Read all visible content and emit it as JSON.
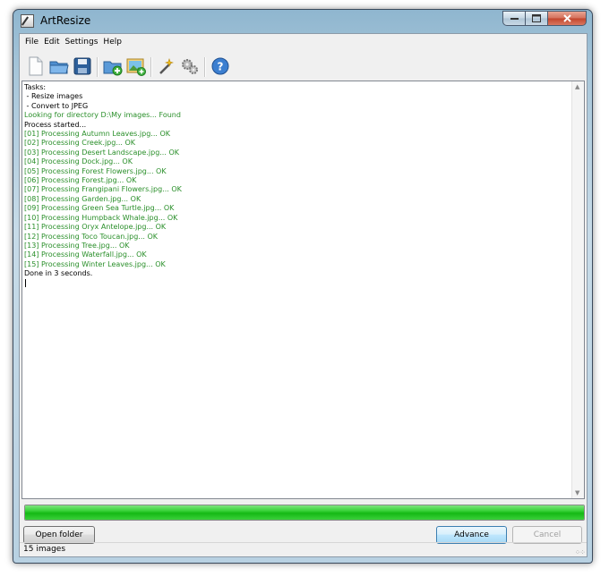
{
  "window": {
    "title": "ArtResize"
  },
  "menu": [
    "File",
    "Edit",
    "Settings",
    "Help"
  ],
  "toolbar": {
    "buttons": [
      "new-file-icon",
      "open-folder-icon",
      "save-icon",
      "add-folder-icon",
      "add-image-icon",
      "magic-wand-icon",
      "settings-gears-icon",
      "help-icon"
    ]
  },
  "log": {
    "lines": [
      {
        "text": "Tasks:",
        "color": "#000000"
      },
      {
        "text": " - Resize images",
        "color": "#000000"
      },
      {
        "text": " - Convert to JPEG",
        "color": "#000000"
      },
      {
        "text": "Looking for directory D:\\My images... Found",
        "color": "#2a8f2a"
      },
      {
        "text": "Process started...",
        "color": "#000000"
      },
      {
        "text": "[01] Processing Autumn Leaves.jpg... OK",
        "color": "#2a8f2a"
      },
      {
        "text": "[02] Processing Creek.jpg... OK",
        "color": "#2a8f2a"
      },
      {
        "text": "[03] Processing Desert Landscape.jpg... OK",
        "color": "#2a8f2a"
      },
      {
        "text": "[04] Processing Dock.jpg... OK",
        "color": "#2a8f2a"
      },
      {
        "text": "[05] Processing Forest Flowers.jpg... OK",
        "color": "#2a8f2a"
      },
      {
        "text": "[06] Processing Forest.jpg... OK",
        "color": "#2a8f2a"
      },
      {
        "text": "[07] Processing Frangipani Flowers.jpg... OK",
        "color": "#2a8f2a"
      },
      {
        "text": "[08] Processing Garden.jpg... OK",
        "color": "#2a8f2a"
      },
      {
        "text": "[09] Processing Green Sea Turtle.jpg... OK",
        "color": "#2a8f2a"
      },
      {
        "text": "[10] Processing Humpback Whale.jpg... OK",
        "color": "#2a8f2a"
      },
      {
        "text": "[11] Processing Oryx Antelope.jpg... OK",
        "color": "#2a8f2a"
      },
      {
        "text": "[12] Processing Toco Toucan.jpg... OK",
        "color": "#2a8f2a"
      },
      {
        "text": "[13] Processing Tree.jpg... OK",
        "color": "#2a8f2a"
      },
      {
        "text": "[14] Processing Waterfall.jpg... OK",
        "color": "#2a8f2a"
      },
      {
        "text": "[15] Processing Winter Leaves.jpg... OK",
        "color": "#2a8f2a"
      },
      {
        "text": "Done in 3 seconds.",
        "color": "#000000"
      }
    ]
  },
  "progress": {
    "value": 1.0,
    "color": "#1ec21e"
  },
  "buttons": {
    "open_folder": "Open folder",
    "advance": "Advance",
    "cancel": "Cancel"
  },
  "status": {
    "text": "15 images"
  }
}
